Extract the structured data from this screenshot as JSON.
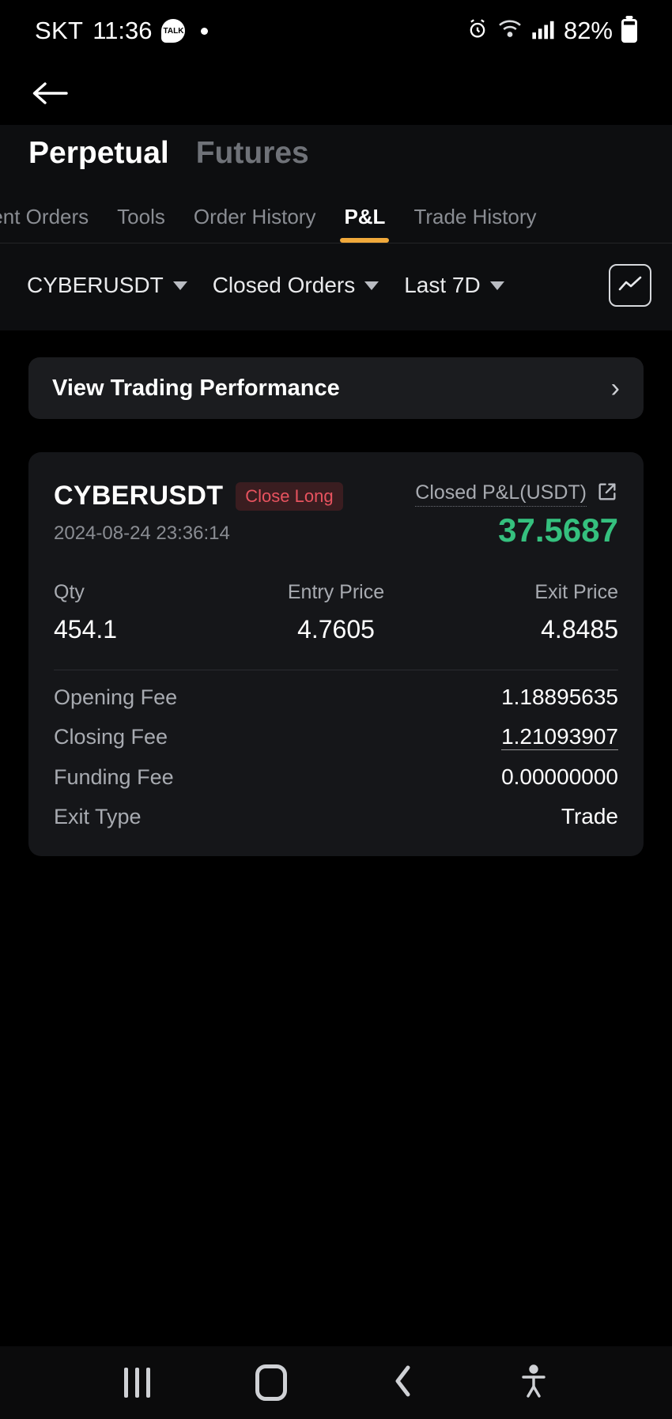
{
  "status_bar": {
    "carrier": "SKT",
    "time": "11:36",
    "kakao_label": "TALK",
    "battery_percent": "82%",
    "icons": [
      "kakaotalk-icon",
      "dot-icon",
      "alarm-icon",
      "wifi-icon",
      "signal-icon",
      "battery-icon"
    ]
  },
  "header": {
    "back_icon": "back-arrow-icon",
    "segments": [
      {
        "label": "Perpetual",
        "active": true
      },
      {
        "label": "Futures",
        "active": false
      }
    ],
    "tabs": [
      {
        "label": "rrent Orders",
        "active": false
      },
      {
        "label": "Tools",
        "active": false
      },
      {
        "label": "Order History",
        "active": false
      },
      {
        "label": "P&L",
        "active": true
      },
      {
        "label": "Trade History",
        "active": false
      }
    ],
    "active_tab_underline_color": "#f0a93b"
  },
  "filters": {
    "symbol": "CYBERUSDT",
    "order_state": "Closed Orders",
    "period": "Last 7D",
    "chart_button_icon": "line-chart-icon"
  },
  "performance_banner": {
    "label": "View Trading Performance",
    "chevron": "›"
  },
  "pnl_card": {
    "symbol": "CYBERUSDT",
    "side_badge": "Close Long",
    "timestamp": "2024-08-24 23:36:14",
    "pnl_label": "Closed P&L(USDT)",
    "pnl_value": "37.5687",
    "pnl_color": "#35c07e",
    "badge_color": "#e8535f",
    "share_icon": "external-link-icon",
    "metrics": [
      {
        "label": "Qty",
        "value": "454.1"
      },
      {
        "label": "Entry Price",
        "value": "4.7605"
      },
      {
        "label": "Exit Price",
        "value": "4.8485"
      }
    ],
    "details": [
      {
        "label": "Opening Fee",
        "value": "1.18895635"
      },
      {
        "label": "Closing Fee",
        "value": "1.21093907"
      },
      {
        "label": "Funding Fee",
        "value": "0.00000000"
      },
      {
        "label": "Exit Type",
        "value": "Trade"
      }
    ]
  },
  "android_nav": {
    "items": [
      "recents-icon",
      "home-icon",
      "back-icon",
      "accessibility-icon"
    ]
  }
}
